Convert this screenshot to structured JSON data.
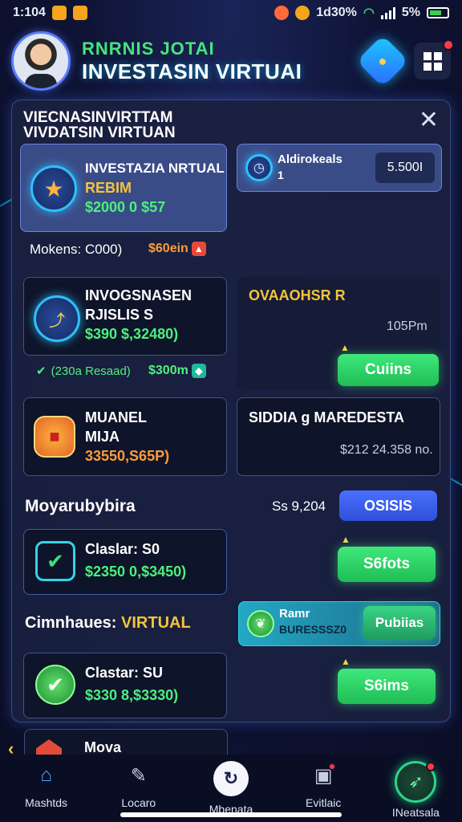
{
  "status_bar": {
    "time": "1:104",
    "right_text": "1d30%",
    "battery": "5%"
  },
  "header": {
    "title_top": "RNRNIS JOTAI",
    "title_main": "INVESTASIN VIRTUAI"
  },
  "panel": {
    "title": "VIECNASINVIRTTAM\nVIVDATSIN VIRTUAN",
    "card1": {
      "title": "INVESTAZIA NRTUAL",
      "sub": "REBIM",
      "amount": "$2000 0 $57"
    },
    "card2": {
      "label": "Aldirokeals",
      "label2": "1",
      "value": "5.500I"
    },
    "row1": {
      "text": "Mokens: C000)",
      "tag": "$60ein"
    },
    "card3": {
      "title": "INVOGSNASEN",
      "sub": "RJISLIS S",
      "amount": "$390 $,32480)"
    },
    "card4": {
      "title": "OVAAOHSR R",
      "value": "105Pm",
      "button": "Cuiins"
    },
    "row2": {
      "left": "(230a Resaad)",
      "right": "$300m"
    },
    "card5": {
      "title": "MUANEL",
      "sub": "MIJA",
      "amount": "33550,S65P)"
    },
    "card6": {
      "title": "SIDDIA g MAREDESTA",
      "value": "$212 24.358 no."
    },
    "section1": {
      "title": "Moyarubybira",
      "value": "Sѕ 9,204",
      "button": "OSISIS"
    },
    "card7": {
      "title": "Claslar: S0",
      "amount": "$2350 0,$3450)",
      "button": "S6fots"
    },
    "section2": {
      "title": "Cimnhaues:",
      "accent": "VIRTUAL"
    },
    "card8": {
      "title": "Ramr",
      "sub": "BURESSSZ0",
      "button": "Pubiias"
    },
    "card9": {
      "title": "Clastar: SU",
      "amount": "$330 8,$3330)",
      "button": "S6ims"
    },
    "card10": {
      "title": "Mova"
    }
  },
  "bottom_nav": [
    {
      "label": "Mashtds",
      "icon": "home-icon"
    },
    {
      "label": "Locaro",
      "icon": "tools-icon"
    },
    {
      "label": "Mbenata",
      "icon": "refresh-icon"
    },
    {
      "label": "Evitlaic",
      "icon": "chart-icon"
    },
    {
      "label": "INeatsala",
      "icon": "rocket-icon"
    }
  ],
  "colors": {
    "accent_green": "#3fe87a",
    "accent_blue": "#4a70ff",
    "accent_orange": "#ff9c3a",
    "background": "#0f1436"
  }
}
